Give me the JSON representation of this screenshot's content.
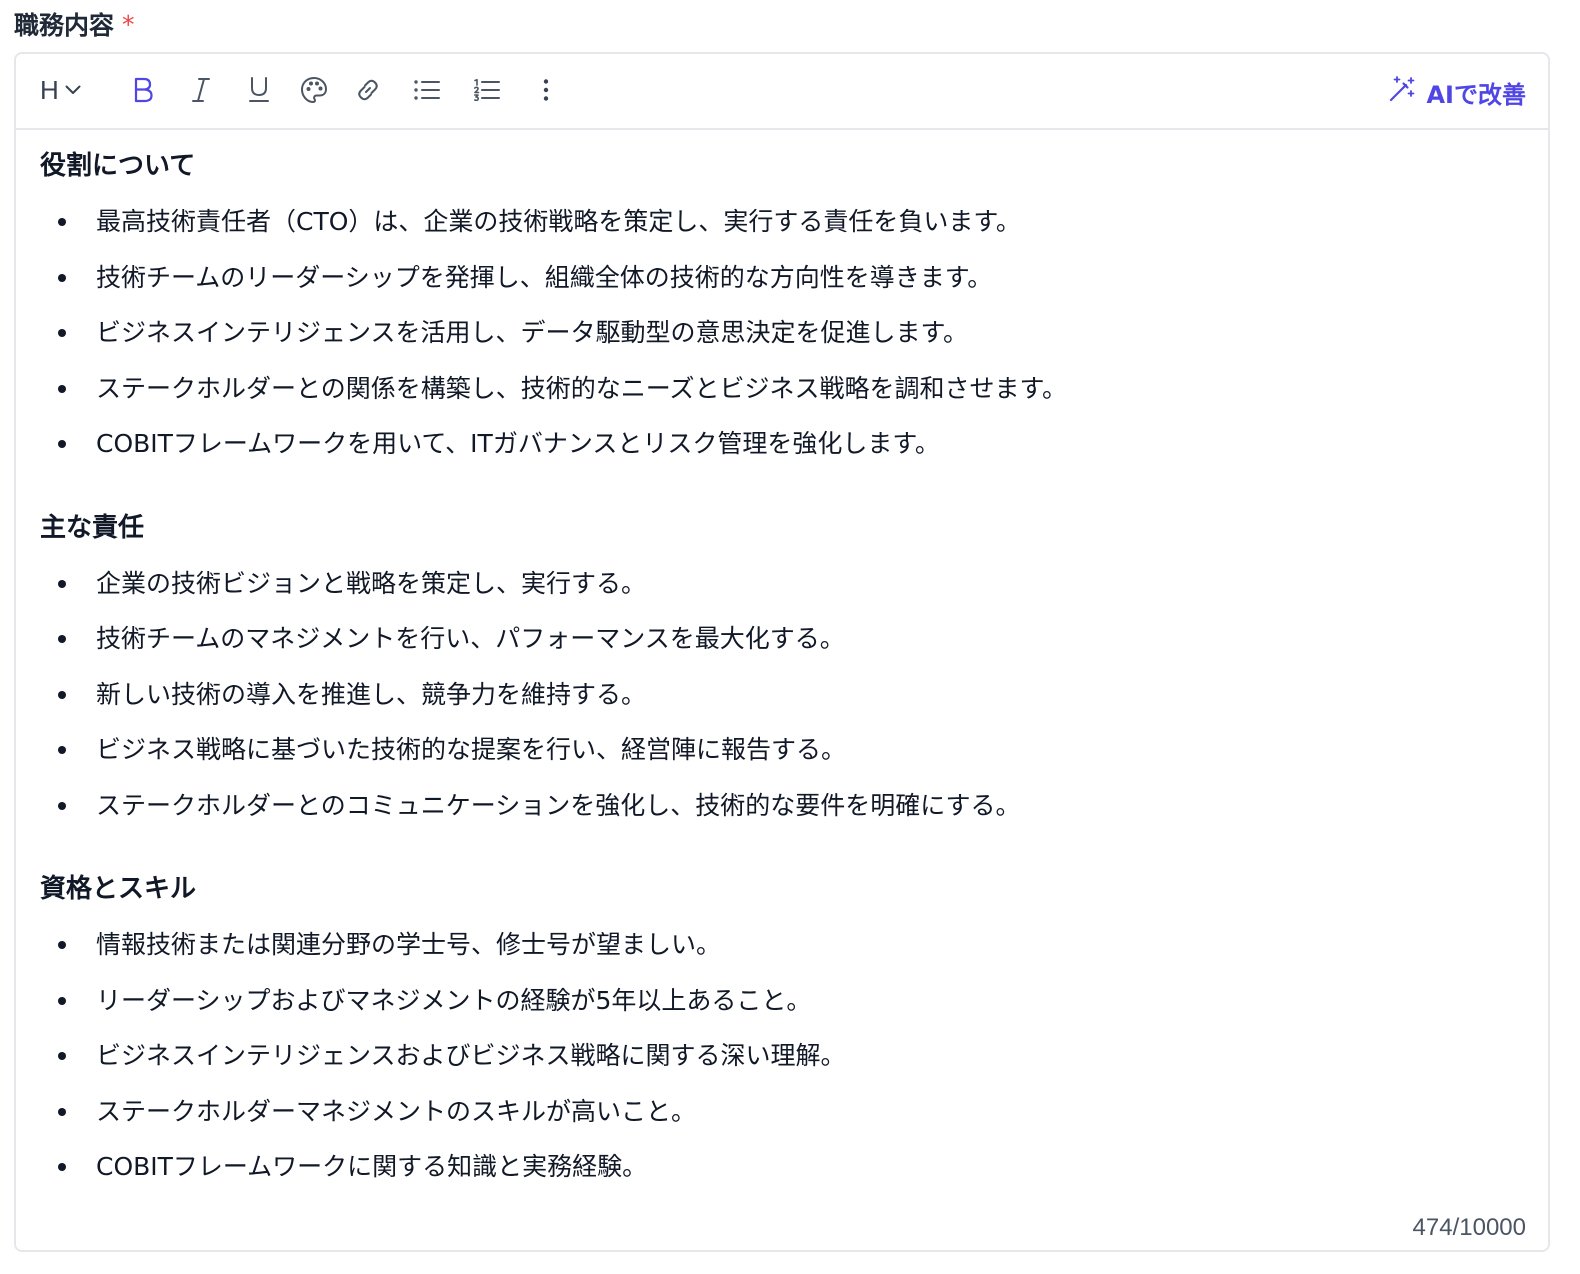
{
  "field": {
    "label": "職務内容",
    "required_mark": "*"
  },
  "toolbar": {
    "heading_label": "H",
    "ai_improve_label": "AIで改善",
    "accent_color": "#4f46e5"
  },
  "sections": [
    {
      "title": "役割について",
      "items": [
        "最高技術責任者（CTO）は、企業の技術戦略を策定し、実行する責任を負います。",
        "技術チームのリーダーシップを発揮し、組織全体の技術的な方向性を導きます。",
        "ビジネスインテリジェンスを活用し、データ駆動型の意思決定を促進します。",
        "ステークホルダーとの関係を構築し、技術的なニーズとビジネス戦略を調和させます。",
        "COBITフレームワークを用いて、ITガバナンスとリスク管理を強化します。"
      ]
    },
    {
      "title": "主な責任",
      "items": [
        "企業の技術ビジョンと戦略を策定し、実行する。",
        "技術チームのマネジメントを行い、パフォーマンスを最大化する。",
        "新しい技術の導入を推進し、競争力を維持する。",
        "ビジネス戦略に基づいた技術的な提案を行い、経営陣に報告する。",
        "ステークホルダーとのコミュニケーションを強化し、技術的な要件を明確にする。"
      ]
    },
    {
      "title": "資格とスキル",
      "items": [
        "情報技術または関連分野の学士号、修士号が望ましい。",
        "リーダーシップおよびマネジメントの経験が5年以上あること。",
        "ビジネスインテリジェンスおよびビジネス戦略に関する深い理解。",
        "ステークホルダーマネジメントのスキルが高いこと。",
        "COBITフレームワークに関する知識と実務経験。"
      ]
    }
  ],
  "counter": {
    "text": "474/10000"
  }
}
